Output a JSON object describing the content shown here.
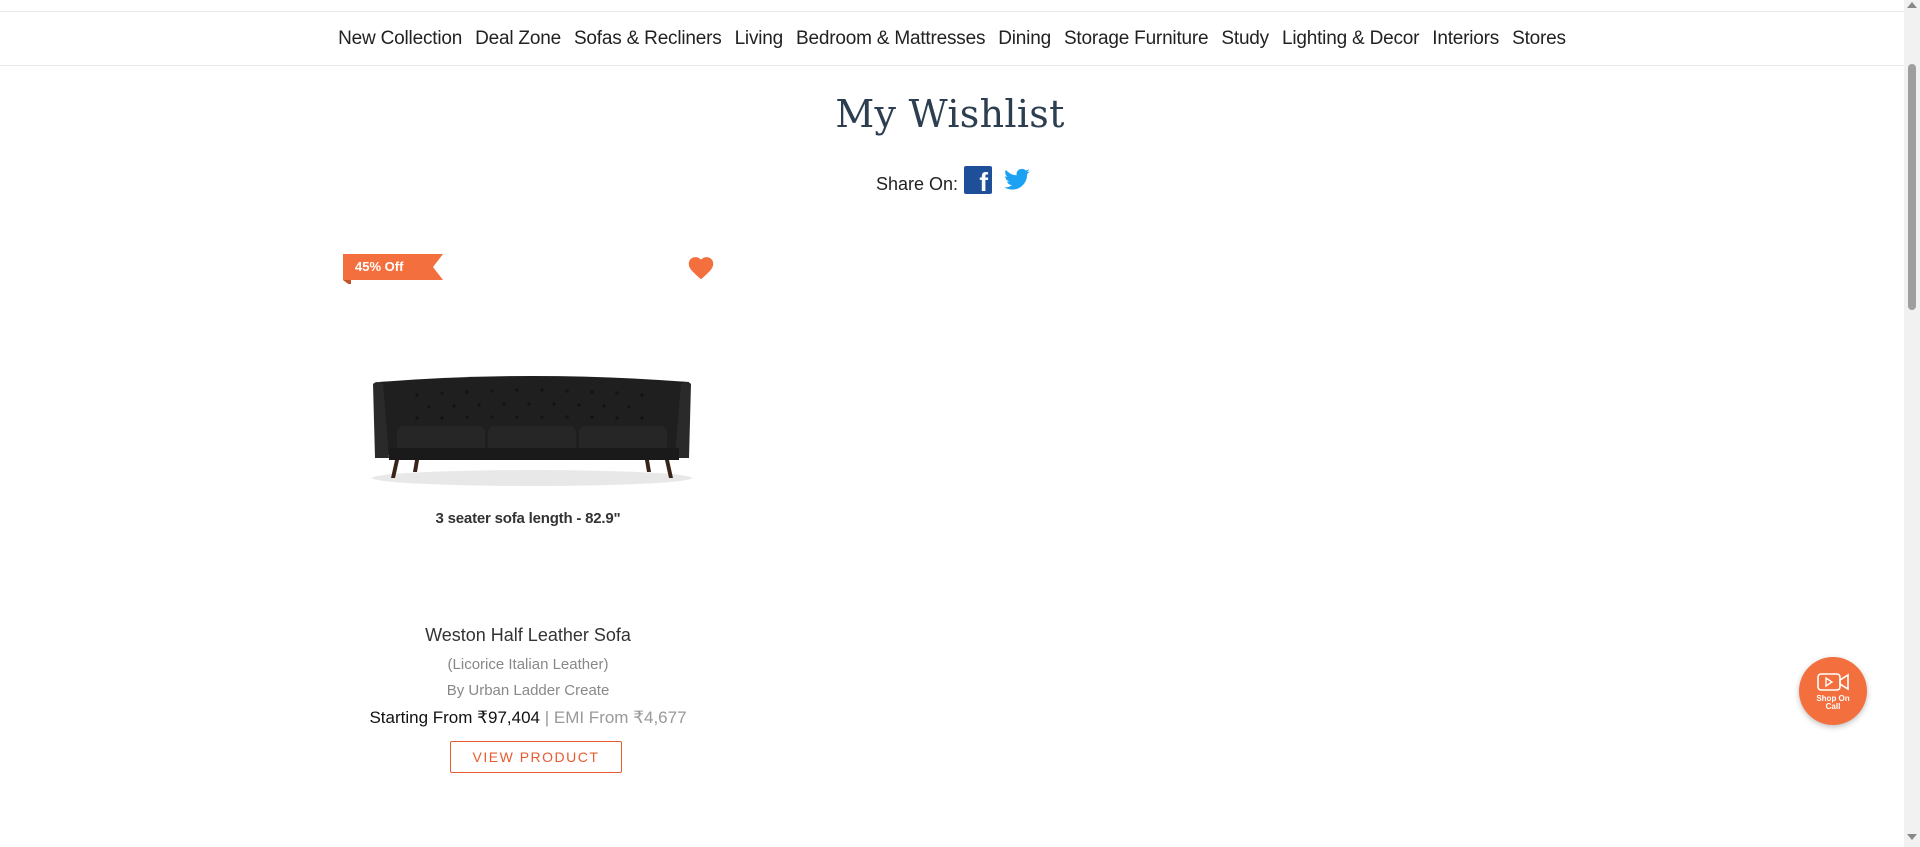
{
  "nav": {
    "items": [
      {
        "label": "New Collection"
      },
      {
        "label": "Deal Zone"
      },
      {
        "label": "Sofas & Recliners"
      },
      {
        "label": "Living"
      },
      {
        "label": "Bedroom & Mattresses"
      },
      {
        "label": "Dining"
      },
      {
        "label": "Storage Furniture"
      },
      {
        "label": "Study"
      },
      {
        "label": "Lighting & Decor"
      },
      {
        "label": "Interiors"
      },
      {
        "label": "Stores"
      }
    ]
  },
  "page": {
    "title": "My Wishlist",
    "share_label": "Share On:",
    "facebook_icon": "facebook-icon",
    "twitter_icon": "twitter-icon"
  },
  "product": {
    "badge": "45% Off",
    "image_caption": "3 seater sofa length - 82.9\"",
    "name": "Weston Half Leather Sofa",
    "variant": "(Licorice Italian Leather)",
    "brand": "By Urban Ladder Create",
    "price_prefix": "Starting From",
    "price": "₹97,404",
    "emi": "| EMI From ₹4,677",
    "view_button": "VIEW PRODUCT"
  },
  "fab": {
    "label": "Shop On Call"
  },
  "colors": {
    "accent": "#f3703e",
    "title": "#2c3e50",
    "facebook": "#1f4f99",
    "twitter": "#1da1f2"
  }
}
